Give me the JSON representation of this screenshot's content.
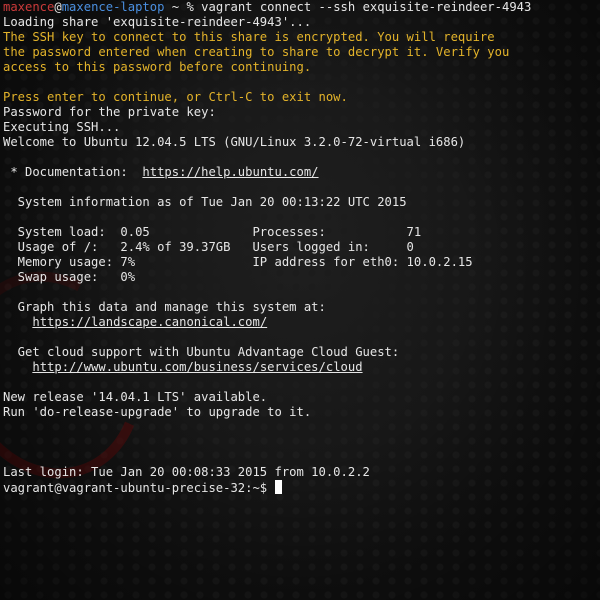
{
  "prompt": {
    "user": "maxence",
    "at": "@",
    "host": "maxence-laptop",
    "path_symbol": " ~ % ",
    "command": "vagrant connect --ssh exquisite-reindeer-4943"
  },
  "lines": {
    "loading_share": "Loading share 'exquisite-reindeer-4943'...",
    "warn_1": "The SSH key to connect to this share is encrypted. You will require",
    "warn_2": "the password entered when creating to share to decrypt it. Verify you",
    "warn_3": "access to this password before continuing.",
    "press_enter": "Press enter to continue, or Ctrl-C to exit now.",
    "password_prompt": "Password for the private key:",
    "executing_ssh": "Executing SSH...",
    "welcome": "Welcome to Ubuntu 12.04.5 LTS (GNU/Linux 3.2.0-72-virtual i686)",
    "documentation_label": " * Documentation:  ",
    "documentation_url": "https://help.ubuntu.com/",
    "sysinfo": "  System information as of Tue Jan 20 00:13:22 UTC 2015",
    "stats_1": "  System load:  0.05              Processes:           71",
    "stats_2": "  Usage of /:   2.4% of 39.37GB   Users logged in:     0",
    "stats_3": "  Memory usage: 7%                IP address for eth0: 10.0.2.15",
    "stats_4": "  Swap usage:   0%",
    "graph_text": "  Graph this data and manage this system at:",
    "graph_indent": "    ",
    "graph_url": "https://landscape.canonical.com/",
    "cloud_text": "  Get cloud support with Ubuntu Advantage Cloud Guest:",
    "cloud_indent": "    ",
    "cloud_url": "http://www.ubuntu.com/business/services/cloud",
    "new_release": "New release '14.04.1 LTS' available.",
    "run_upgrade": "Run 'do-release-upgrade' to upgrade to it.",
    "last_login": "Last login: Tue Jan 20 00:08:33 2015 from 10.0.2.2",
    "final_prompt": "vagrant@vagrant-ubuntu-precise-32:~$ "
  },
  "colors": {
    "background": "#121212",
    "text": "#e6e6e6",
    "user": "#cc3a3a",
    "host": "#4a8fe0",
    "warning": "#e3b32a",
    "cursor": "#ffffff"
  }
}
